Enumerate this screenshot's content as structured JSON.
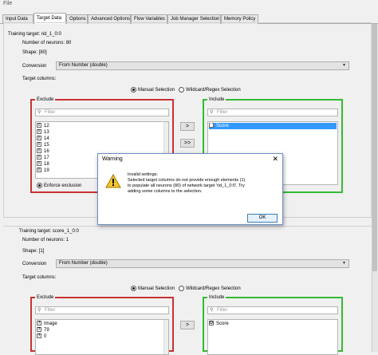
{
  "menubar": {
    "file_label": "File"
  },
  "tabs": [
    {
      "label": "Input Data"
    },
    {
      "label": "Target Data"
    },
    {
      "label": "Options"
    },
    {
      "label": "Advanced Options"
    },
    {
      "label": "Flow Variables"
    },
    {
      "label": "Job Manager Selection"
    },
    {
      "label": "Memory Policy"
    }
  ],
  "section1": {
    "title": "Training target: rid_1_0:0",
    "neurons_label": "Number of neurons: 80",
    "shape_label": "Shape: [80]",
    "conversion_label": "Conversion",
    "conversion_value": "From Number (double)",
    "target_columns_label": "Target columns:",
    "radio_manual": "Manual Selection",
    "radio_wildcard": "Wildcard/Regex Selection",
    "exclude_title": "Exclude",
    "include_title": "Include",
    "filter_placeholder": "Filter",
    "exclude_rows": [
      {
        "type": "I",
        "name": "12"
      },
      {
        "type": "I",
        "name": "13"
      },
      {
        "type": "I",
        "name": "14"
      },
      {
        "type": "I",
        "name": "15"
      },
      {
        "type": "I",
        "name": "16"
      },
      {
        "type": "I",
        "name": "17"
      },
      {
        "type": "I",
        "name": "18"
      },
      {
        "type": "I",
        "name": "19"
      }
    ],
    "include_rows": [
      {
        "type": "D",
        "name": "Score"
      }
    ],
    "enforce_exclusion": "Enforce exclusion"
  },
  "section2": {
    "title": "Training target: score_1_0:0",
    "neurons_label": "Number of neurons: 1",
    "shape_label": "Shape: [1]",
    "conversion_label": "Conversion",
    "conversion_value": "From Number (double)",
    "target_columns_label": "Target columns:",
    "radio_manual": "Manual Selection",
    "radio_wildcard": "Wildcard/Regex Selection",
    "exclude_title": "Exclude",
    "include_title": "Include",
    "filter_placeholder": "Filter",
    "exclude_rows": [
      {
        "type": "?",
        "name": "Image"
      },
      {
        "type": "?",
        "name": "79"
      },
      {
        "type": "?",
        "name": "0"
      }
    ],
    "include_rows": [
      {
        "type": "D",
        "name": "Score"
      }
    ]
  },
  "buttons": {
    "add": ">",
    "add_all": ">>",
    "remove": ">"
  },
  "dialog": {
    "title": "Warning",
    "close": "✕",
    "message_line1": "Invalid settings:",
    "message_line2": "Selected target columns do not provide enough elements (1)",
    "message_line3": "to populate all neurons (80) of network target 'rid_1_0:0'. Try",
    "message_line4": "adding some columns to the selection.",
    "ok_label": "OK"
  },
  "colors": {
    "exclude_border": "#c83232",
    "include_border": "#33bb33",
    "warning_icon": "#f4c430"
  }
}
